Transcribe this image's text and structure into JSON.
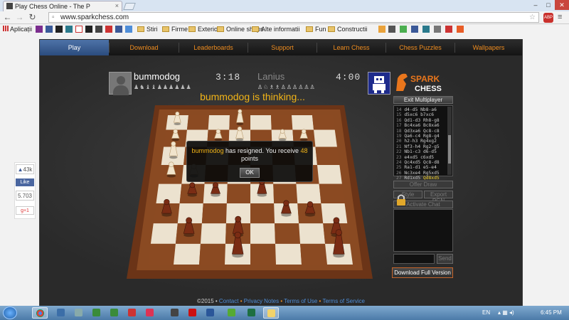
{
  "browser": {
    "tab_title": "Play Chess Online - The P",
    "url": "www.sparkchess.com",
    "extension_badge": "ABP",
    "bookmarks": [
      "Aplicații",
      "Stiri",
      "Firme",
      "Exterior",
      "Online shops",
      "Alte informatii",
      "Fun",
      "Constructii"
    ]
  },
  "menu": {
    "items": [
      "Play",
      "Download",
      "Leaderboards",
      "Support",
      "Learn Chess",
      "Chess Puzzles",
      "Wallpapers"
    ],
    "active": "Play"
  },
  "game": {
    "player1": {
      "name": "bummodog",
      "clock": "3:18",
      "captured": "♟♞♝♝♟♟♟♟♟♟"
    },
    "player2": {
      "name": "Lanius",
      "clock": "4:00",
      "captured": "♙♘♗♗♙♙♙♙♙♙"
    },
    "status": "bummodog is thinking...",
    "logo_line1": "SPARK",
    "logo_line2": "CHESS"
  },
  "panel": {
    "exit_label": "Exit Multiplayer",
    "moves": [
      {
        "w": "d4-d5",
        "b": "Nb8-a6"
      },
      {
        "w": "d5xc6",
        "b": "b7xc6"
      },
      {
        "w": "Qd1-d3",
        "b": "Rh8-g8"
      },
      {
        "w": "Bc4xa6",
        "b": "Bc8xa6"
      },
      {
        "w": "Qd3xa6",
        "b": "Qc8-c8"
      },
      {
        "w": "Qa6-c4",
        "b": "Rg8-g4"
      },
      {
        "w": "h2-h3",
        "b": "Rg4xg2"
      },
      {
        "w": "Nf3-h4",
        "b": "Rg2-g5"
      },
      {
        "w": "Nb1-c3",
        "b": "d6-d5"
      },
      {
        "w": "e4xd5",
        "b": "c6xd5"
      },
      {
        "w": "Qc4xd5",
        "b": "Qc8-d8"
      },
      {
        "w": "Ra1-d1",
        "b": "e5-e4"
      },
      {
        "w": "Nc3xe4",
        "b": "Rg5xd5"
      },
      {
        "w": "Rd1xd5",
        "b": "Qd8xd5"
      }
    ],
    "move_numbers": [
      "14",
      "15",
      "16",
      "17",
      "18",
      "19",
      "20",
      "21",
      "22",
      "23",
      "24",
      "25",
      "26",
      "27"
    ],
    "offer_draw": "Offer Draw",
    "style": "Style",
    "export_pgn": "Export PGN",
    "hide_chat": "Activate Chat",
    "send": "Send",
    "download": "Download Full Version"
  },
  "dialog": {
    "name": "bummodog",
    "text_before": " has resigned. You receive ",
    "points": "48",
    "text_after": "points",
    "ok": "OK"
  },
  "footer": {
    "copyright": "©2015 • ",
    "contact": "Contact",
    "privacy": "Privacy Notes",
    "terms": "Terms of Use",
    "service": "Terms of Service"
  },
  "social": {
    "count1": "43k",
    "like": "Like",
    "count2": "5.703",
    "gplus": "g+1"
  },
  "taskbar": {
    "lang": "EN",
    "time": "6:45 PM"
  }
}
